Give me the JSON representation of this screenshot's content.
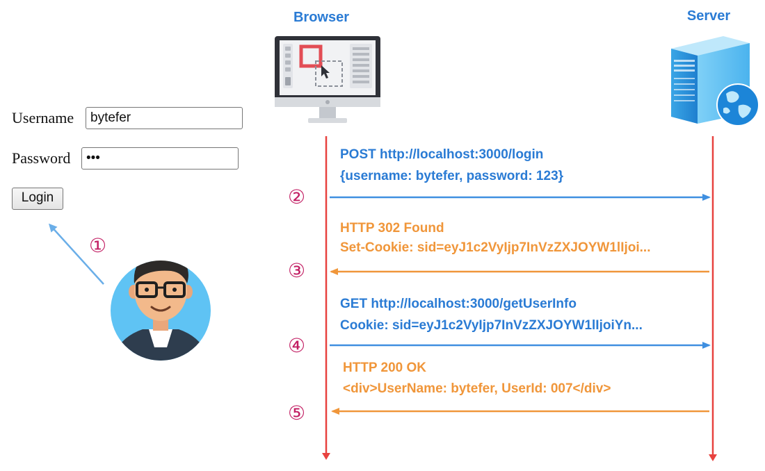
{
  "login_form": {
    "username_label": "Username",
    "username_value": "bytefer",
    "password_label": "Password",
    "password_value": "•••",
    "login_button_label": "Login"
  },
  "actors": {
    "browser_label": "Browser",
    "server_label": "Server"
  },
  "steps": {
    "step1": "①",
    "step2": "②",
    "step3": "③",
    "step4": "④",
    "step5": "⑤"
  },
  "messages": {
    "post_request_line": "POST http://localhost:3000/login",
    "post_request_body": "{username: bytefer, password: 123}",
    "found_status": "HTTP 302 Found",
    "set_cookie_header": "Set-Cookie: sid=eyJ1c2VyIjp7InVzZXJOYW1lIjoi...",
    "get_request_line": "GET http://localhost:3000/getUserInfo",
    "cookie_header": "Cookie: sid=eyJ1c2VyIjp7InVzZXJOYW1lIjoiYn...",
    "ok_status": "HTTP 200 OK",
    "ok_body": "<div>UserName: bytefer, UserId: 007</div>"
  },
  "colors": {
    "blue_text": "#2a7bd4",
    "orange_text": "#f0963a",
    "lifeline": "#e8423f",
    "step_number": "#c21e63",
    "request_arrow": "#3f8fe0",
    "response_arrow": "#f0963a"
  },
  "icons": {
    "browser": "computer-monitor-icon",
    "server": "server-tower-icon",
    "user": "user-avatar-icon"
  }
}
